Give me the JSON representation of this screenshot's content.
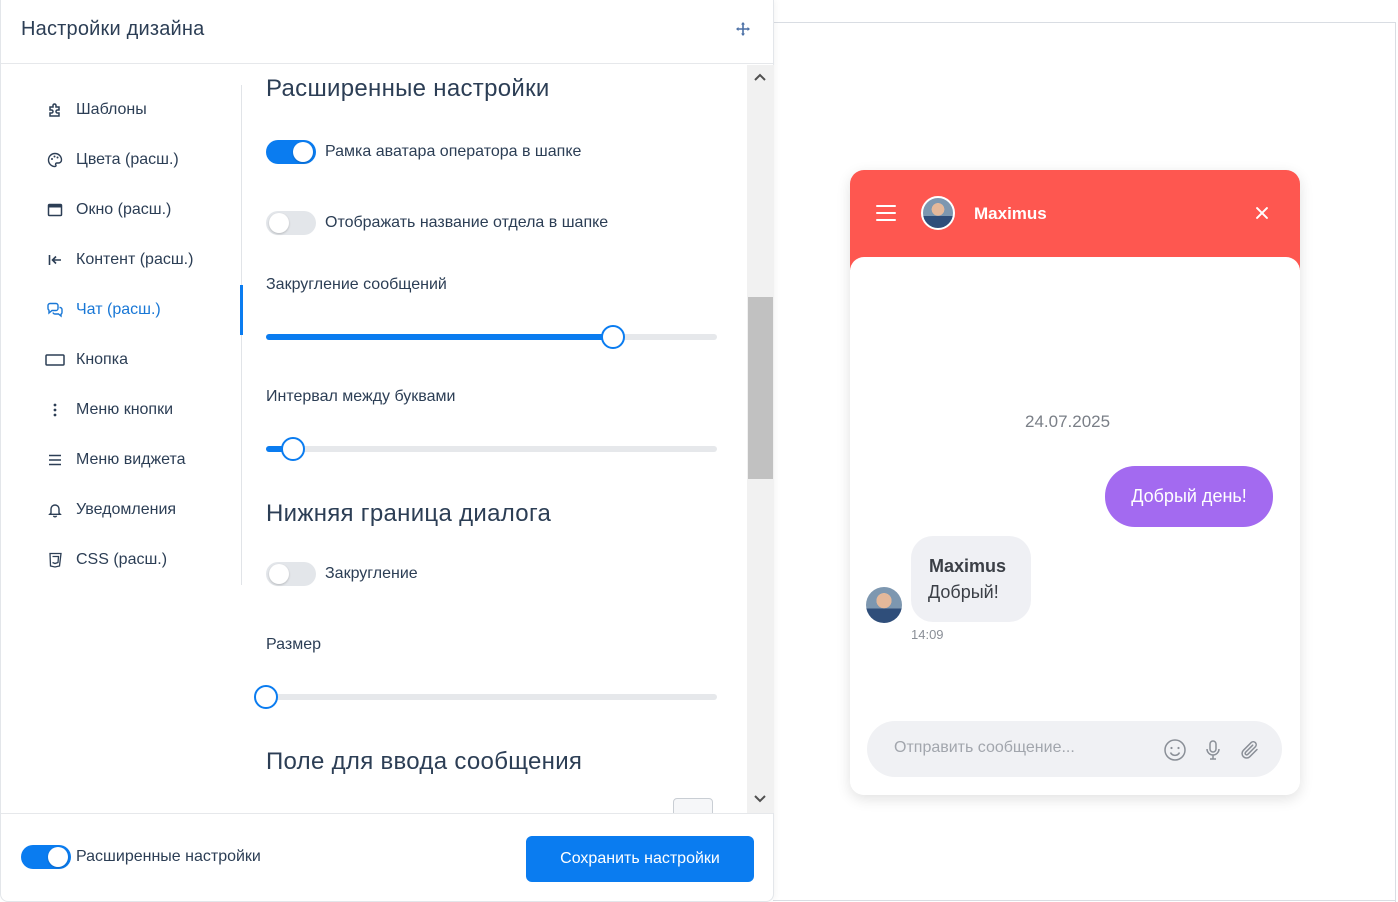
{
  "panel": {
    "title": "Настройки дизайна"
  },
  "nav": {
    "items": [
      {
        "label": "Шаблоны",
        "icon": "puzzle-icon"
      },
      {
        "label": "Цвета (расш.)",
        "icon": "palette-icon"
      },
      {
        "label": "Окно (расш.)",
        "icon": "window-icon"
      },
      {
        "label": "Контент (расш.)",
        "icon": "arrow-left-bar-icon"
      },
      {
        "label": "Чат (расш.)",
        "icon": "chat-bubbles-icon",
        "active": true
      },
      {
        "label": "Кнопка",
        "icon": "button-rect-icon"
      },
      {
        "label": "Меню кнопки",
        "icon": "dots-vertical-icon"
      },
      {
        "label": "Меню виджета",
        "icon": "menu-lines-icon"
      },
      {
        "label": "Уведомления",
        "icon": "bell-icon"
      },
      {
        "label": "CSS (расш.)",
        "icon": "css-icon"
      }
    ]
  },
  "content": {
    "advanced_heading": "Расширенные настройки",
    "avatar_frame_label": "Рамка аватара оператора в шапке",
    "avatar_frame_on": true,
    "dept_name_label": "Отображать название отдела в шапке",
    "dept_name_on": false,
    "rounding_label": "Закругление сообщений",
    "rounding_level": 0.77,
    "letter_spacing_label": "Интервал между буквами",
    "letter_spacing_level": 0.06,
    "bottom_heading": "Нижняя граница диалога",
    "bottom_rounding_label": "Закругление",
    "bottom_rounding_on": false,
    "size_label": "Размер",
    "size_level": 0.0,
    "input_heading": "Поле для ввода сообщения"
  },
  "footer": {
    "advanced_label": "Расширенные настройки",
    "advanced_on": true,
    "save_label": "Сохранить настройки"
  },
  "widget": {
    "header_color": "#fe5750",
    "agent_name": "Maximus",
    "date": "24.07.2025",
    "outgoing_message": "Добрый день!",
    "outgoing_color": "#a36af0",
    "incoming_name": "Maximus",
    "incoming_message": "Добрый!",
    "incoming_time": "14:09",
    "input_placeholder": "Отправить сообщение..."
  },
  "accent_color": "#0a7cf0"
}
